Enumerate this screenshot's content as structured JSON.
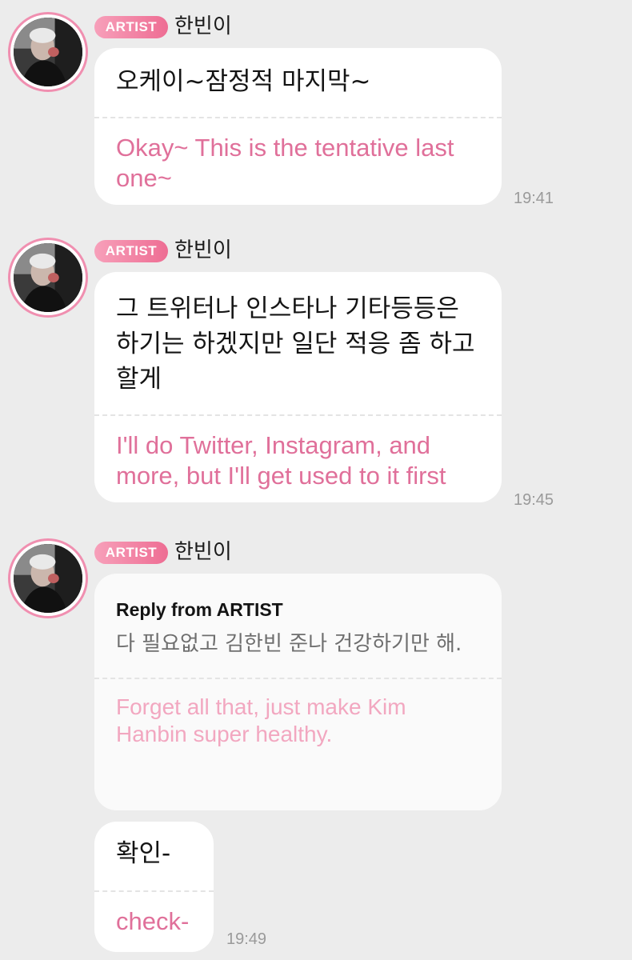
{
  "messages": [
    {
      "badge": "ARTIST",
      "username": "한빈이",
      "original": "오케이~잠정적 마지막~",
      "translation": "Okay~ This is the tentative last one~",
      "time": "19:41"
    },
    {
      "badge": "ARTIST",
      "username": "한빈이",
      "original": "그 트위터나 인스타나 기타등등은 하기는 하겠지만 일단 적응 좀 하고 할게",
      "translation": "I'll do Twitter, Instagram, and more, but I'll get used to it first",
      "time": "19:45"
    },
    {
      "badge": "ARTIST",
      "username": "한빈이",
      "reply": {
        "heading": "Reply from ARTIST",
        "original": "다 필요없고 김한빈 준나 건강하기만 해.",
        "translation": "Forget all that, just make Kim Hanbin super healthy."
      },
      "followup": {
        "original": "확인-",
        "translation": "check-"
      },
      "time": "19:49"
    }
  ],
  "colors": {
    "background": "#ececec",
    "bubble": "#ffffff",
    "translation_text": "#e0709a",
    "badge_start": "#f7a0ba",
    "badge_end": "#ee6d93",
    "avatar_ring": "#f08fb0"
  },
  "icons": {
    "avatar": "artist-profile-photo"
  }
}
